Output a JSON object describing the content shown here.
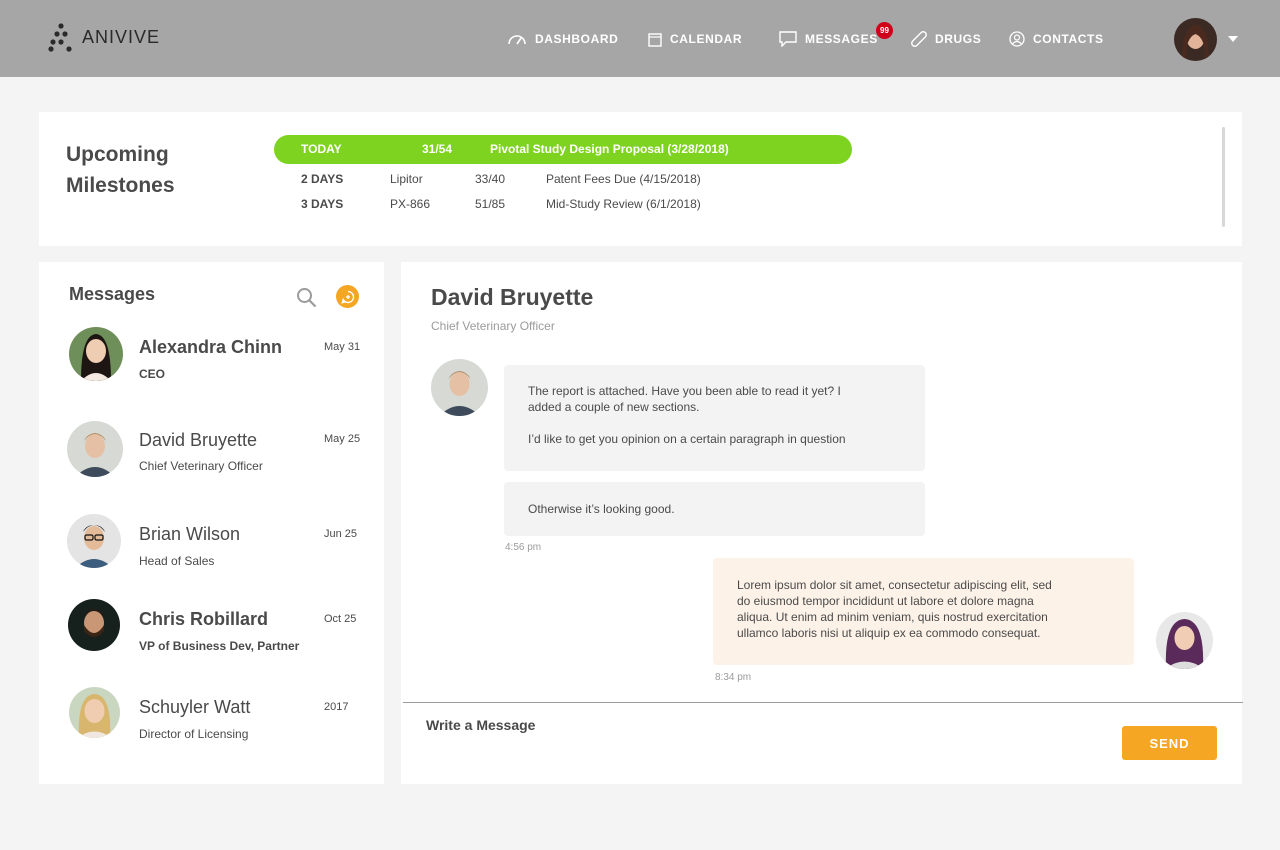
{
  "header": {
    "logo_text": "ANIVIVE",
    "nav": [
      {
        "label": "DASHBOARD",
        "icon": "speedometer-icon"
      },
      {
        "label": "CALENDAR",
        "icon": "calendar-icon"
      },
      {
        "label": "MESSAGES",
        "icon": "chat-icon"
      },
      {
        "label": "DRUGS",
        "icon": "pill-icon"
      },
      {
        "label": "CONTACTS",
        "icon": "contacts-icon"
      }
    ],
    "messages_badge": "99",
    "colors": {
      "bar": "#a6a6a6",
      "badge": "#d0021b"
    }
  },
  "milestones": {
    "title": "Upcoming Milestones",
    "rows": [
      {
        "when": "TODAY",
        "drug": "",
        "count": "31/54",
        "event": "Pivotal Study Design Proposal (3/28/2018)",
        "highlight": true
      },
      {
        "when": "2 DAYS",
        "drug": "Lipitor",
        "count": "33/40",
        "event": "Patent Fees Due (4/15/2018)",
        "highlight": false
      },
      {
        "when": "3 DAYS",
        "drug": "PX-866",
        "count": "51/85",
        "event": "Mid-Study Review (6/1/2018)",
        "highlight": false
      }
    ],
    "highlight_color": "#7ed321"
  },
  "messages": {
    "title": "Messages",
    "contacts": [
      {
        "name": "Alexandra Chinn",
        "role": "CEO",
        "date": "May 31",
        "unread": true
      },
      {
        "name": "David Bruyette",
        "role": "Chief Veterinary Officer",
        "date": "May 25",
        "unread": false
      },
      {
        "name": "Brian Wilson",
        "role": "Head of Sales",
        "date": "Jun 25",
        "unread": false
      },
      {
        "name": "Chris Robillard",
        "role": "VP of Business Dev, Partner",
        "date": "Oct 25",
        "unread": true
      },
      {
        "name": "Schuyler Watt",
        "role": "Director of Licensing",
        "date": "2017",
        "unread": false
      }
    ],
    "accent": "#f5a623"
  },
  "conversation": {
    "name": "David Bruyette",
    "role": "Chief Veterinary Officer",
    "messages": [
      {
        "lines": [
          "The report is attached. Have you been able to read it yet? I",
          "added a couple of new sections.",
          "",
          "I’d like to get you opinion on a certain paragraph in question"
        ]
      },
      {
        "lines": [
          "Otherwise it’s looking good."
        ],
        "time": "4:56 pm"
      },
      {
        "lines": [
          "Lorem ipsum dolor sit amet, consectetur adipiscing elit, sed",
          "do eiusmod tempor incididunt ut labore et dolore magna",
          "aliqua. Ut enim ad minim veniam, quis nostrud exercitation",
          "ullamco laboris nisi ut aliquip ex ea commodo consequat."
        ],
        "time": "8:34 pm"
      }
    ],
    "input_placeholder": "Write a Message",
    "send_label": "SEND"
  }
}
